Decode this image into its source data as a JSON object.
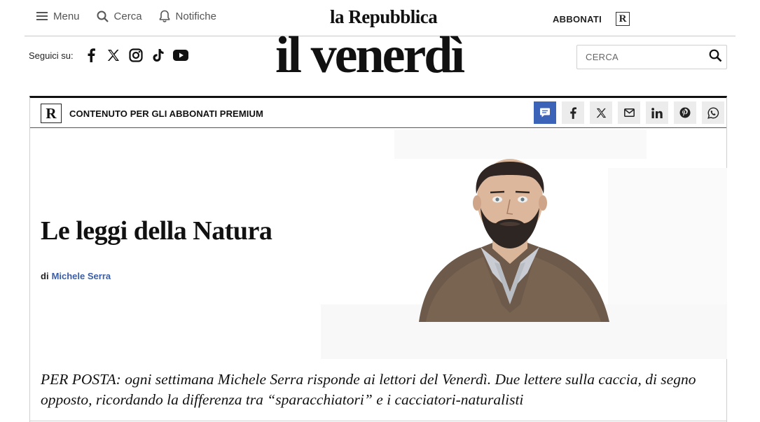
{
  "topbar": {
    "menu_label": "Menu",
    "search_label": "Cerca",
    "notifications_label": "Notifiche",
    "brand": "la Repubblica",
    "subscribe_label": "ABBONATI",
    "r_badge": "R"
  },
  "follow": {
    "label": "Seguici su:",
    "icons": [
      "facebook-icon",
      "x-icon",
      "instagram-icon",
      "tiktok-icon",
      "youtube-icon"
    ]
  },
  "masthead": {
    "title": "il venerdì"
  },
  "search": {
    "placeholder": "CERCA"
  },
  "premium": {
    "badge": "R",
    "label": "CONTENUTO PER GLI ABBONATI PREMIUM"
  },
  "share": {
    "icons": [
      "comment-icon",
      "facebook-icon",
      "x-icon",
      "email-icon",
      "linkedin-icon",
      "pinterest-icon",
      "whatsapp-icon"
    ]
  },
  "article": {
    "headline": "Le leggi della Natura",
    "byline_prefix": "di",
    "author": "Michele Serra",
    "summary": "PER POSTA: ogni settimana Michele Serra risponde ai lettori del Venerdì. Due lettere sulla caccia, di segno opposto, ricordando la differenza tra “sparacchiatori” e i cacciatori-naturalisti"
  },
  "colors": {
    "accent": "#3b63b8",
    "author_link": "#3b5ea8",
    "share_bg": "#ececec"
  }
}
